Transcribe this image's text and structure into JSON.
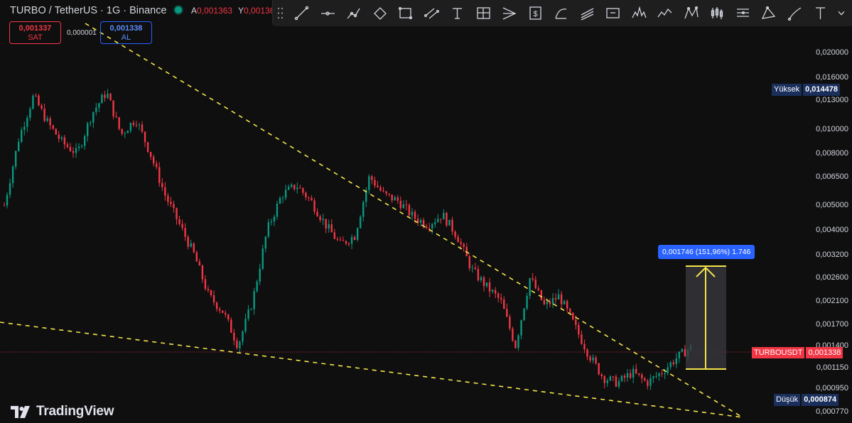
{
  "header": {
    "symbol_title": "TURBO / TetherUS · 1G · Binance",
    "ohlc": {
      "open_key": "A",
      "open_value": "0,001363",
      "high_key": "Y",
      "high_value": "0,00136"
    }
  },
  "trade": {
    "sell_price": "0,001337",
    "sell_label": "SAT",
    "spread": "0,000001",
    "buy_price": "0,001338",
    "buy_label": "AL"
  },
  "toolbar": {
    "tools": [
      "trend-line-icon",
      "horizontal-ray-icon",
      "polyline-icon",
      "rectangle-rotated-icon",
      "rectangle-icon",
      "parallel-channel-icon",
      "text-icon",
      "fib-grid-icon",
      "pitchfork-icon",
      "price-label-icon",
      "arc-icon",
      "fib-channel-icon",
      "price-range-icon",
      "head-shoulders-icon",
      "elliott-wave-icon",
      "xabcd-pattern-icon",
      "bars-pattern-icon",
      "fib-levels-icon",
      "triangle-pattern-icon",
      "brush-icon",
      "text-tool-icon"
    ],
    "more_icon": "chevron-down-icon"
  },
  "price_axis": {
    "labels": [
      "0,020000",
      "0,016000",
      "0,013000",
      "0,010000",
      "0,008000",
      "0,006500",
      "0,005000",
      "0,004000",
      "0,003200",
      "0,002600",
      "0,002100",
      "0,001700",
      "0,001400",
      "0,001150",
      "0,000950",
      "0,000770"
    ]
  },
  "markers": {
    "high_name": "Yüksek",
    "high_value": "0,014478",
    "low_name": "Düşük",
    "low_value": "0,000874",
    "current_name": "TURBOUSDT",
    "current_value": "0,001338"
  },
  "measure": {
    "label": "0,001746 (151,96%) 1.746"
  },
  "branding": {
    "logo_text": "TradingView"
  },
  "colors": {
    "up": "#089981",
    "down": "#f23645",
    "trendline": "#f5e54a",
    "accent": "#2962ff",
    "background": "#0f0f0f"
  },
  "chart_data": {
    "type": "candlestick",
    "symbol": "TURBOUSDT",
    "interval": "1G",
    "scale": "log",
    "ylim": [
      0.00077,
      0.021
    ],
    "y_ticks": [
      0.02,
      0.016,
      0.013,
      0.01,
      0.008,
      0.0065,
      0.005,
      0.004,
      0.0032,
      0.0026,
      0.0021,
      0.0017,
      0.0014,
      0.00115,
      0.00095,
      0.00077
    ],
    "series_close_keypoints": [
      0.005,
      0.0092,
      0.0135,
      0.0105,
      0.0088,
      0.008,
      0.0115,
      0.014,
      0.0095,
      0.011,
      0.008,
      0.0055,
      0.0042,
      0.0032,
      0.0022,
      0.0019,
      0.0014,
      0.0021,
      0.004,
      0.0055,
      0.006,
      0.0052,
      0.0042,
      0.0035,
      0.0038,
      0.0065,
      0.0055,
      0.0052,
      0.0045,
      0.0042,
      0.0046,
      0.0038,
      0.0028,
      0.0024,
      0.0021,
      0.0014,
      0.0026,
      0.002,
      0.0022,
      0.0017,
      0.0013,
      0.00105,
      0.001,
      0.0011,
      0.001,
      0.0011,
      0.00125,
      0.00138
    ],
    "high": 0.014478,
    "low": 0.000874,
    "last": 0.001338,
    "annotations": {
      "upper_trendline": [
        [
          0.0215,
          0.0012
        ]
      ],
      "lower_trendline": [
        [
          0.0017,
          0.00077
        ]
      ],
      "measure_range": {
        "from": 0.00115,
        "to": 0.0029,
        "label": "0,001746 (151,96%) 1.746"
      }
    }
  }
}
